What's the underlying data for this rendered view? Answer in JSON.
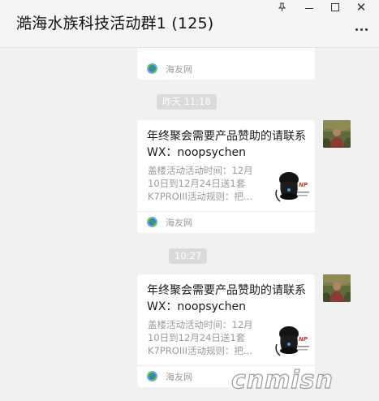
{
  "window": {
    "title": "澔海水族科技活动群1 (125)",
    "controls": {
      "pin_icon": "pin-icon",
      "minimize_icon": "minimize-icon",
      "maximize_icon": "maximize-icon",
      "close_glyph": "✕",
      "more_icon": "more-dots-icon"
    }
  },
  "messages": [
    {
      "type": "link_card_partial",
      "source": "海友网",
      "source_icon": "haiyou-logo-icon"
    },
    {
      "type": "timestamp",
      "text": "昨天 11:18"
    },
    {
      "type": "link_card",
      "title": "年终聚会需要产品赞助的请联系\nWX：noopsychen",
      "description": "盖楼活动活动时间：12月\n10日到12月24日送1套\nK7PROIII活动规则：把...",
      "thumbnail": "k7pro-product-image",
      "source": "海友网",
      "source_icon": "haiyou-logo-icon"
    },
    {
      "type": "timestamp",
      "text": "10:27"
    },
    {
      "type": "link_card",
      "title": "年终聚会需要产品赞助的请联系\nWX：noopsychen",
      "description": "盖楼活动活动时间：12月\n10日到12月24日送1套\nK7PROIII活动规则：把...",
      "thumbnail": "k7pro-product-image",
      "source": "海友网",
      "source_icon": "haiyou-logo-icon"
    }
  ],
  "watermark": "cnmisn"
}
